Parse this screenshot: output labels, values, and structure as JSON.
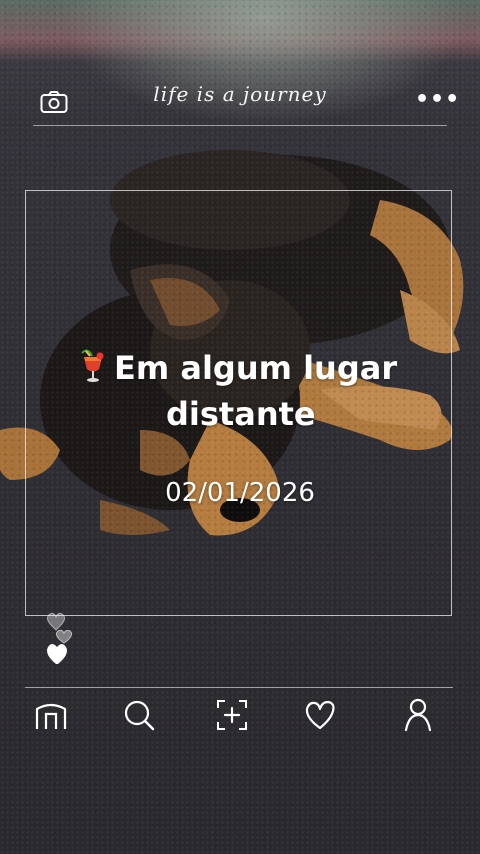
{
  "header": {
    "title": "life is a journey",
    "camera_icon": "camera-icon",
    "more_icon": "more-dots-icon",
    "more_label": "•••"
  },
  "card": {
    "emoji_icon": "tropical-drink-icon",
    "headline_line1": "Em algum lugar",
    "headline_line2": "distante",
    "date": "02/01/2026"
  },
  "reactions": {
    "icons": [
      "heart-outline-icon",
      "heart-outline-icon",
      "heart-filled-icon"
    ]
  },
  "bottom_nav": {
    "items": [
      {
        "icon": "home-icon"
      },
      {
        "icon": "search-icon"
      },
      {
        "icon": "add-post-icon"
      },
      {
        "icon": "likes-heart-icon"
      },
      {
        "icon": "profile-icon"
      }
    ]
  },
  "colors": {
    "text": "#ffffff",
    "dog_black": "#1e1a1a",
    "dog_tan": "#b07a3e",
    "blanket": "#2e2d33"
  }
}
